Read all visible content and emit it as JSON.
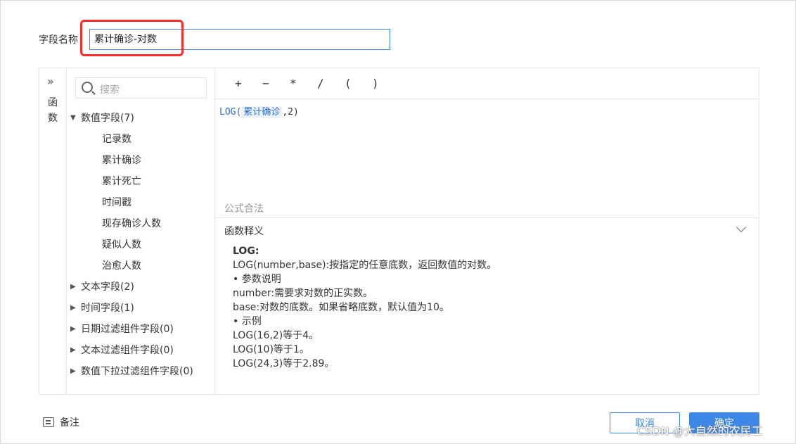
{
  "field": {
    "label": "字段名称",
    "value": "累计确诊-对数"
  },
  "rail": {
    "expand_glyph": "»",
    "label_chars": [
      "函",
      "数"
    ]
  },
  "search": {
    "placeholder": "搜索"
  },
  "tree": {
    "numeric_group": {
      "label": "数值字段(7)",
      "expanded": true,
      "items": [
        "记录数",
        "累计确诊",
        "累计死亡",
        "时间戳",
        "现存确诊人数",
        "疑似人数",
        "治愈人数"
      ]
    },
    "collapsed_groups": [
      "文本字段(2)",
      "时间字段(1)",
      "日期过滤组件字段(0)",
      "文本过滤组件字段(0)",
      "数值下拉过滤组件字段(0)"
    ]
  },
  "operators": [
    "+",
    "−",
    "*",
    "/",
    "(",
    ")"
  ],
  "formula": {
    "prefix": "LOG(",
    "field": "累计确诊",
    "suffix": ",2)"
  },
  "validation": "公式合法",
  "explain": {
    "title": "函数释义",
    "name": "LOG:",
    "lines": [
      "LOG(number,base):按指定的任意底数，返回数值的对数。",
      "• 参数说明",
      "number:需要求对数的正实数。",
      "base:对数的底数。如果省略底数，默认值为10。",
      "• 示例",
      "LOG(16,2)等于4。",
      "LOG(10)等于1。",
      "LOG(24,3)等于2.89。"
    ]
  },
  "footer": {
    "note_label": "备注",
    "cancel_label": "取消",
    "ok_label": "确定"
  },
  "watermark": "CSDN @大自然的农民工",
  "colors": {
    "accent": "#3d88e6",
    "highlight": "#ff2a2a"
  }
}
